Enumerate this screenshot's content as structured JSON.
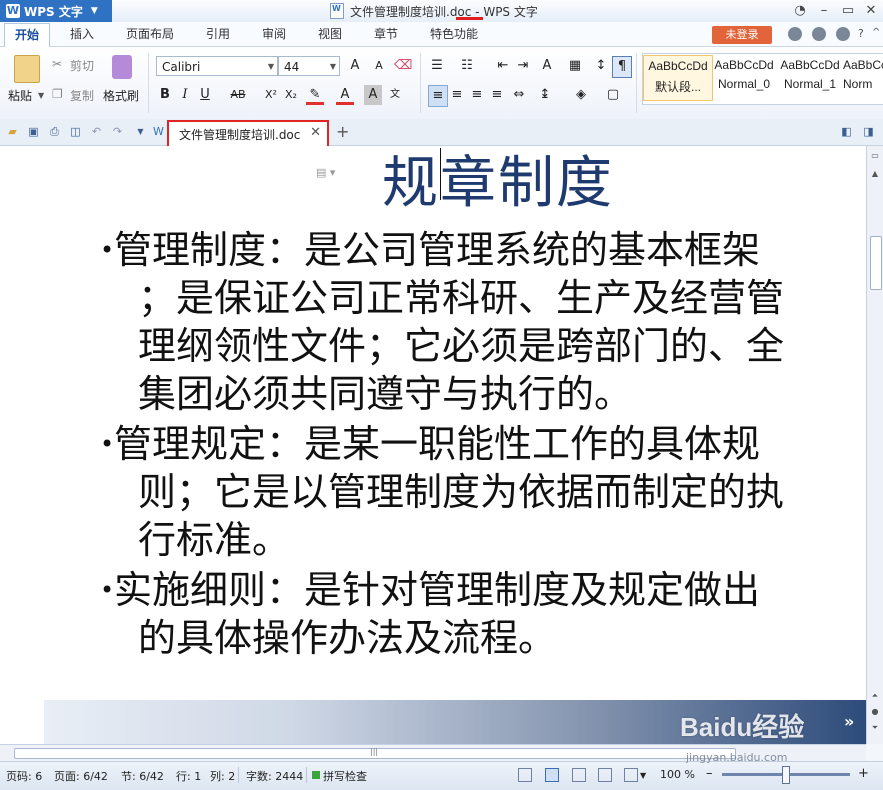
{
  "app": {
    "menu_label": "WPS 文字",
    "window_title": "文件管理制度培训.doc - WPS 文字"
  },
  "menu_tabs": [
    "开始",
    "插入",
    "页面布局",
    "引用",
    "审阅",
    "视图",
    "章节",
    "特色功能"
  ],
  "login_label": "未登录",
  "ribbon": {
    "paste_label": "粘贴",
    "cut_label": "剪切",
    "copy_label": "复制",
    "format_painter_label": "格式刷",
    "font_name": "Calibri",
    "font_size": "44",
    "style_sample": "AaBbCcDd",
    "styles": [
      "默认段...",
      "Normal_0",
      "Normal_1",
      "Norm"
    ]
  },
  "doc_tab": {
    "name": "文件管理制度培训.doc"
  },
  "document": {
    "title": "规章制度",
    "paragraphs": [
      {
        "lines": [
          "管理制度：是公司管理系统的基本框架",
          "；是保证公司正常科研、生产及经营管",
          "理纲领性文件；它必须是跨部门的、全",
          "集团必须共同遵守与执行的。"
        ]
      },
      {
        "lines": [
          "管理规定：是某一职能性工作的具体规",
          "则；它是以管理制度为依据而制定的执",
          "行标准。"
        ]
      },
      {
        "lines": [
          "实施细则：是针对管理制度及规定做出",
          "的具体操作办法及流程。"
        ]
      }
    ]
  },
  "status": {
    "page_code": "页码: 6",
    "page": "页面: 6/42",
    "section": "节: 6/42",
    "row": "行: 1",
    "col": "列: 2",
    "word_count": "字数: 2444",
    "spell_check": "拼写检查",
    "zoom": "100 %",
    "zoom_level": 0.5
  },
  "watermark": {
    "brand": "Baidu经验",
    "url": "jingyan.baidu.com"
  },
  "colors": {
    "accent": "#2f72c4",
    "highlight_box": "#e02424",
    "title_text": "#1e3a6e",
    "login_button": "#e2643a"
  }
}
